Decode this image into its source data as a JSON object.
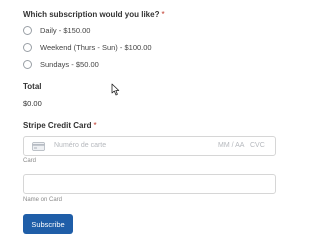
{
  "subscription": {
    "question": "Which subscription would you like?",
    "required_mark": "*",
    "options": [
      {
        "label": "Daily - $150.00"
      },
      {
        "label": "Weekend (Thurs - Sun) - $100.00"
      },
      {
        "label": "Sundays - $50.00"
      }
    ]
  },
  "total": {
    "label": "Total",
    "value": "$0.00"
  },
  "stripe": {
    "label": "Stripe Credit Card",
    "required_mark": "*",
    "card_number_placeholder": "Numéro de carte",
    "expiry_placeholder": "MM / AA",
    "cvc_placeholder": "CVC",
    "card_sublabel": "Card",
    "name_value": "",
    "name_sublabel": "Name on Card"
  },
  "submit": {
    "label": "Subscribe"
  },
  "colors": {
    "button_bg": "#1f5ea8",
    "required": "#c0392b"
  },
  "icons": {
    "card": "credit-card-icon",
    "cursor": "mouse-cursor-icon"
  }
}
